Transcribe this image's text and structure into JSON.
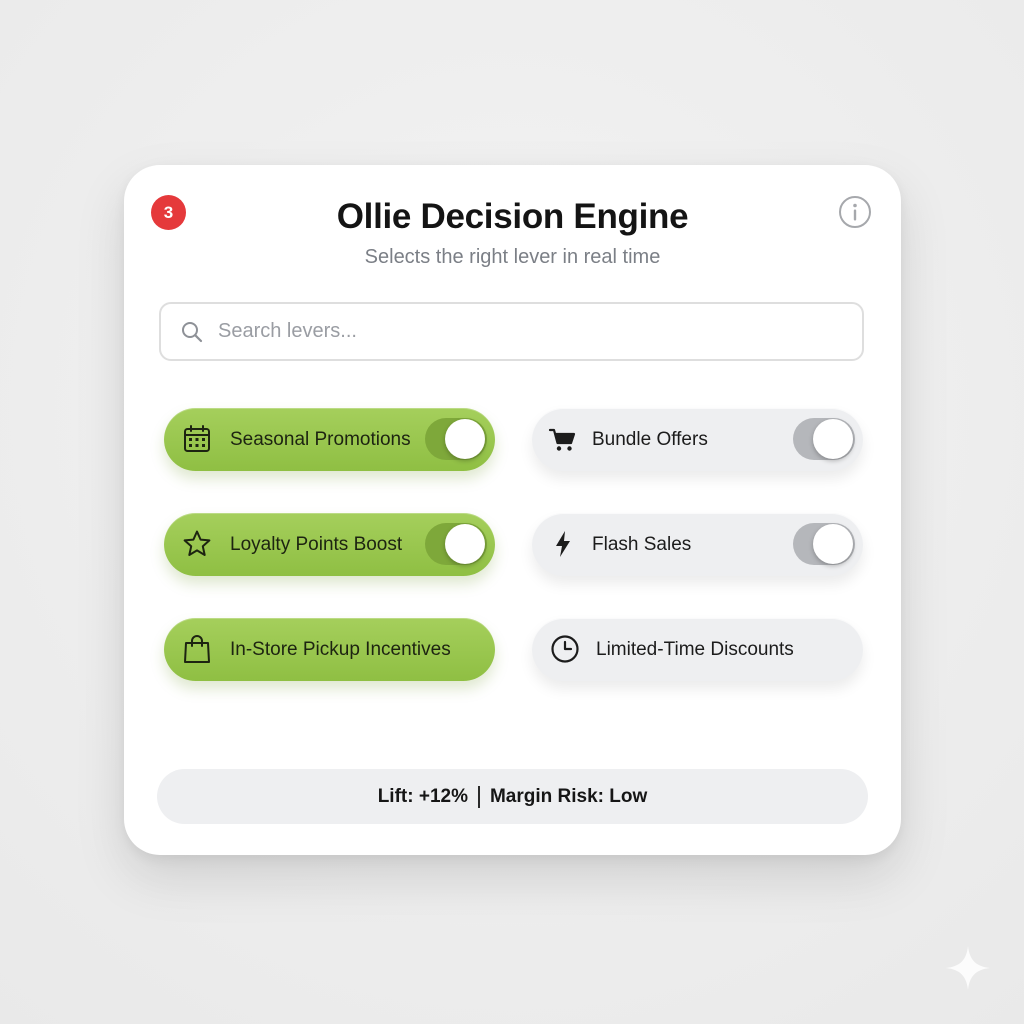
{
  "header": {
    "badge_count": "3",
    "title": "Ollie Decision Engine",
    "subtitle": "Selects the right lever in real time",
    "info_icon": "info-icon"
  },
  "search": {
    "placeholder": "Search levers...",
    "value": "",
    "icon": "search-icon"
  },
  "colors": {
    "accent_on": "#98c64d",
    "inactive": "#eeeff1",
    "badge": "#e5393b"
  },
  "levers": [
    {
      "label": "Seasonal Promotions",
      "icon": "calendar-icon",
      "active": true,
      "has_toggle": true,
      "toggle_on": true
    },
    {
      "label": "Bundle Offers",
      "icon": "cart-icon",
      "active": false,
      "has_toggle": true,
      "toggle_on": true
    },
    {
      "label": "Loyalty Points Boost",
      "icon": "star-icon",
      "active": true,
      "has_toggle": true,
      "toggle_on": true
    },
    {
      "label": "Flash Sales",
      "icon": "lightning-icon",
      "active": false,
      "has_toggle": true,
      "toggle_on": true
    },
    {
      "label": "In-Store Pickup Incentives",
      "icon": "shopping-bag-icon",
      "active": true,
      "has_toggle": false
    },
    {
      "label": "Limited-Time Discounts",
      "icon": "clock-icon",
      "active": false,
      "has_toggle": false
    }
  ],
  "status": {
    "lift": "Lift: +12%",
    "margin_risk": "Margin Risk: Low"
  }
}
